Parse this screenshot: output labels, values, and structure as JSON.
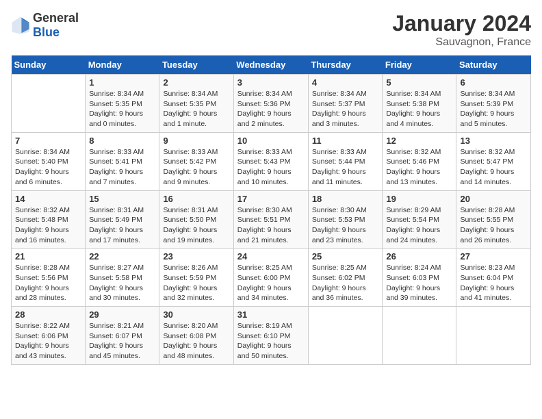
{
  "logo": {
    "text_general": "General",
    "text_blue": "Blue"
  },
  "title": "January 2024",
  "subtitle": "Sauvagnon, France",
  "days_of_week": [
    "Sunday",
    "Monday",
    "Tuesday",
    "Wednesday",
    "Thursday",
    "Friday",
    "Saturday"
  ],
  "weeks": [
    [
      {
        "num": "",
        "sunrise": "",
        "sunset": "",
        "daylight": ""
      },
      {
        "num": "1",
        "sunrise": "Sunrise: 8:34 AM",
        "sunset": "Sunset: 5:35 PM",
        "daylight": "Daylight: 9 hours and 0 minutes."
      },
      {
        "num": "2",
        "sunrise": "Sunrise: 8:34 AM",
        "sunset": "Sunset: 5:35 PM",
        "daylight": "Daylight: 9 hours and 1 minute."
      },
      {
        "num": "3",
        "sunrise": "Sunrise: 8:34 AM",
        "sunset": "Sunset: 5:36 PM",
        "daylight": "Daylight: 9 hours and 2 minutes."
      },
      {
        "num": "4",
        "sunrise": "Sunrise: 8:34 AM",
        "sunset": "Sunset: 5:37 PM",
        "daylight": "Daylight: 9 hours and 3 minutes."
      },
      {
        "num": "5",
        "sunrise": "Sunrise: 8:34 AM",
        "sunset": "Sunset: 5:38 PM",
        "daylight": "Daylight: 9 hours and 4 minutes."
      },
      {
        "num": "6",
        "sunrise": "Sunrise: 8:34 AM",
        "sunset": "Sunset: 5:39 PM",
        "daylight": "Daylight: 9 hours and 5 minutes."
      }
    ],
    [
      {
        "num": "7",
        "sunrise": "Sunrise: 8:34 AM",
        "sunset": "Sunset: 5:40 PM",
        "daylight": "Daylight: 9 hours and 6 minutes."
      },
      {
        "num": "8",
        "sunrise": "Sunrise: 8:33 AM",
        "sunset": "Sunset: 5:41 PM",
        "daylight": "Daylight: 9 hours and 7 minutes."
      },
      {
        "num": "9",
        "sunrise": "Sunrise: 8:33 AM",
        "sunset": "Sunset: 5:42 PM",
        "daylight": "Daylight: 9 hours and 9 minutes."
      },
      {
        "num": "10",
        "sunrise": "Sunrise: 8:33 AM",
        "sunset": "Sunset: 5:43 PM",
        "daylight": "Daylight: 9 hours and 10 minutes."
      },
      {
        "num": "11",
        "sunrise": "Sunrise: 8:33 AM",
        "sunset": "Sunset: 5:44 PM",
        "daylight": "Daylight: 9 hours and 11 minutes."
      },
      {
        "num": "12",
        "sunrise": "Sunrise: 8:32 AM",
        "sunset": "Sunset: 5:46 PM",
        "daylight": "Daylight: 9 hours and 13 minutes."
      },
      {
        "num": "13",
        "sunrise": "Sunrise: 8:32 AM",
        "sunset": "Sunset: 5:47 PM",
        "daylight": "Daylight: 9 hours and 14 minutes."
      }
    ],
    [
      {
        "num": "14",
        "sunrise": "Sunrise: 8:32 AM",
        "sunset": "Sunset: 5:48 PM",
        "daylight": "Daylight: 9 hours and 16 minutes."
      },
      {
        "num": "15",
        "sunrise": "Sunrise: 8:31 AM",
        "sunset": "Sunset: 5:49 PM",
        "daylight": "Daylight: 9 hours and 17 minutes."
      },
      {
        "num": "16",
        "sunrise": "Sunrise: 8:31 AM",
        "sunset": "Sunset: 5:50 PM",
        "daylight": "Daylight: 9 hours and 19 minutes."
      },
      {
        "num": "17",
        "sunrise": "Sunrise: 8:30 AM",
        "sunset": "Sunset: 5:51 PM",
        "daylight": "Daylight: 9 hours and 21 minutes."
      },
      {
        "num": "18",
        "sunrise": "Sunrise: 8:30 AM",
        "sunset": "Sunset: 5:53 PM",
        "daylight": "Daylight: 9 hours and 23 minutes."
      },
      {
        "num": "19",
        "sunrise": "Sunrise: 8:29 AM",
        "sunset": "Sunset: 5:54 PM",
        "daylight": "Daylight: 9 hours and 24 minutes."
      },
      {
        "num": "20",
        "sunrise": "Sunrise: 8:28 AM",
        "sunset": "Sunset: 5:55 PM",
        "daylight": "Daylight: 9 hours and 26 minutes."
      }
    ],
    [
      {
        "num": "21",
        "sunrise": "Sunrise: 8:28 AM",
        "sunset": "Sunset: 5:56 PM",
        "daylight": "Daylight: 9 hours and 28 minutes."
      },
      {
        "num": "22",
        "sunrise": "Sunrise: 8:27 AM",
        "sunset": "Sunset: 5:58 PM",
        "daylight": "Daylight: 9 hours and 30 minutes."
      },
      {
        "num": "23",
        "sunrise": "Sunrise: 8:26 AM",
        "sunset": "Sunset: 5:59 PM",
        "daylight": "Daylight: 9 hours and 32 minutes."
      },
      {
        "num": "24",
        "sunrise": "Sunrise: 8:25 AM",
        "sunset": "Sunset: 6:00 PM",
        "daylight": "Daylight: 9 hours and 34 minutes."
      },
      {
        "num": "25",
        "sunrise": "Sunrise: 8:25 AM",
        "sunset": "Sunset: 6:02 PM",
        "daylight": "Daylight: 9 hours and 36 minutes."
      },
      {
        "num": "26",
        "sunrise": "Sunrise: 8:24 AM",
        "sunset": "Sunset: 6:03 PM",
        "daylight": "Daylight: 9 hours and 39 minutes."
      },
      {
        "num": "27",
        "sunrise": "Sunrise: 8:23 AM",
        "sunset": "Sunset: 6:04 PM",
        "daylight": "Daylight: 9 hours and 41 minutes."
      }
    ],
    [
      {
        "num": "28",
        "sunrise": "Sunrise: 8:22 AM",
        "sunset": "Sunset: 6:06 PM",
        "daylight": "Daylight: 9 hours and 43 minutes."
      },
      {
        "num": "29",
        "sunrise": "Sunrise: 8:21 AM",
        "sunset": "Sunset: 6:07 PM",
        "daylight": "Daylight: 9 hours and 45 minutes."
      },
      {
        "num": "30",
        "sunrise": "Sunrise: 8:20 AM",
        "sunset": "Sunset: 6:08 PM",
        "daylight": "Daylight: 9 hours and 48 minutes."
      },
      {
        "num": "31",
        "sunrise": "Sunrise: 8:19 AM",
        "sunset": "Sunset: 6:10 PM",
        "daylight": "Daylight: 9 hours and 50 minutes."
      },
      {
        "num": "",
        "sunrise": "",
        "sunset": "",
        "daylight": ""
      },
      {
        "num": "",
        "sunrise": "",
        "sunset": "",
        "daylight": ""
      },
      {
        "num": "",
        "sunrise": "",
        "sunset": "",
        "daylight": ""
      }
    ]
  ]
}
